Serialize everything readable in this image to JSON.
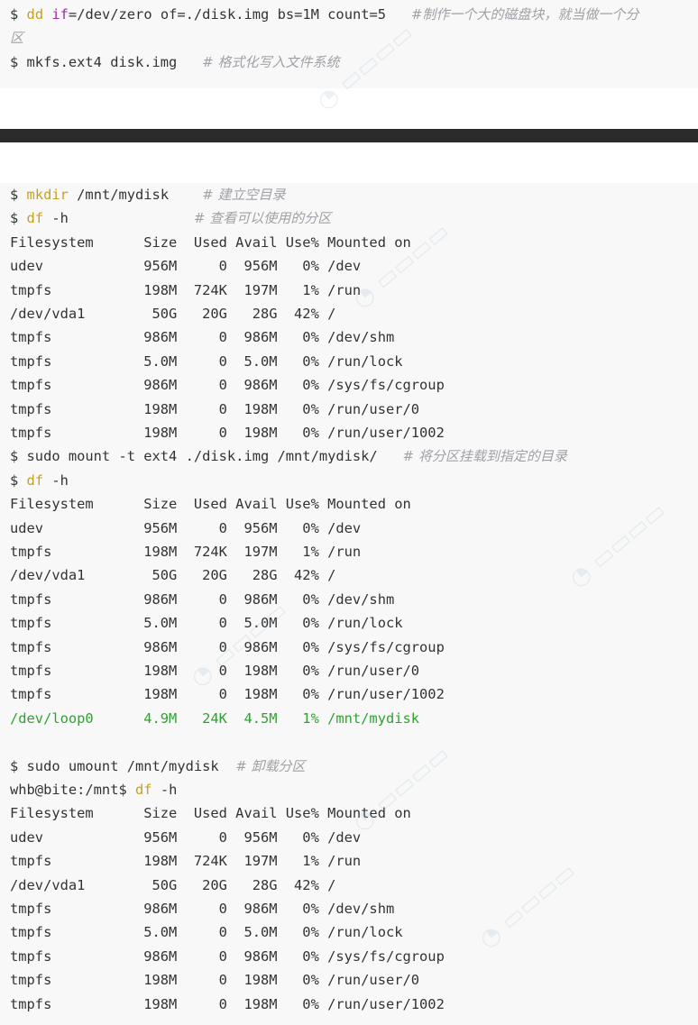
{
  "block1": {
    "line1": {
      "prompt": "$ ",
      "cmd": "dd",
      "sp1": " ",
      "kw": "if",
      "rest": "=/dev/zero of=./disk.img bs=1M count=5   ",
      "comment": "#制作一个大的磁盘块，就当做一个分"
    },
    "line1_wrap": "区",
    "line2": {
      "text": "$ mkfs.ext4 disk.img   ",
      "comment": "# 格式化写入文件系统"
    }
  },
  "block2": {
    "mkdir": {
      "prompt": "$ ",
      "cmd": "mkdir",
      "args": " /mnt/mydisk    ",
      "comment": "# 建立空目录"
    },
    "df1": {
      "prompt": "$ ",
      "cmd": "df",
      "args": " -h               ",
      "comment": "# 查看可以使用的分区"
    },
    "table1": [
      "Filesystem      Size  Used Avail Use% Mounted on",
      "udev            956M     0  956M   0% /dev",
      "tmpfs           198M  724K  197M   1% /run",
      "/dev/vda1        50G   20G   28G  42% /",
      "tmpfs           986M     0  986M   0% /dev/shm",
      "tmpfs           5.0M     0  5.0M   0% /run/lock",
      "tmpfs           986M     0  986M   0% /sys/fs/cgroup",
      "tmpfs           198M     0  198M   0% /run/user/0",
      "tmpfs           198M     0  198M   0% /run/user/1002"
    ],
    "mount": {
      "text": "$ sudo mount -t ext4 ./disk.img /mnt/mydisk/   ",
      "comment": "# 将分区挂载到指定的目录"
    },
    "df2": {
      "prompt": "$ ",
      "cmd": "df",
      "args": " -h"
    },
    "table2": [
      "Filesystem      Size  Used Avail Use% Mounted on",
      "udev            956M     0  956M   0% /dev",
      "tmpfs           198M  724K  197M   1% /run",
      "/dev/vda1        50G   20G   28G  42% /",
      "tmpfs           986M     0  986M   0% /dev/shm",
      "tmpfs           5.0M     0  5.0M   0% /run/lock",
      "tmpfs           986M     0  986M   0% /sys/fs/cgroup",
      "tmpfs           198M     0  198M   0% /run/user/0",
      "tmpfs           198M     0  198M   0% /run/user/1002"
    ],
    "table2_loop": "/dev/loop0      4.9M   24K  4.5M   1% /mnt/mydisk",
    "umount": {
      "text": "$ sudo umount /mnt/mydisk  ",
      "comment": "# 卸载分区"
    },
    "df3": {
      "prompt": "whb@bite:/mnt$ ",
      "cmd": "df",
      "args": " -h"
    },
    "table3": [
      "Filesystem      Size  Used Avail Use% Mounted on",
      "udev            956M     0  956M   0% /dev",
      "tmpfs           198M  724K  197M   1% /run",
      "/dev/vda1        50G   20G   28G  42% /",
      "tmpfs           986M     0  986M   0% /dev/shm",
      "tmpfs           5.0M     0  5.0M   0% /run/lock",
      "tmpfs           986M     0  986M   0% /sys/fs/cgroup",
      "tmpfs           198M     0  198M   0% /run/user/0",
      "tmpfs           198M     0  198M   0% /run/user/1002"
    ]
  },
  "colors": {
    "code_bg": "#f8f8f8",
    "keyword": "#c7a01c",
    "keyword_if": "#a626a4",
    "comment": "#a0a1a7",
    "highlight_green": "#2fa32f",
    "divider": "#2b2b2b"
  }
}
